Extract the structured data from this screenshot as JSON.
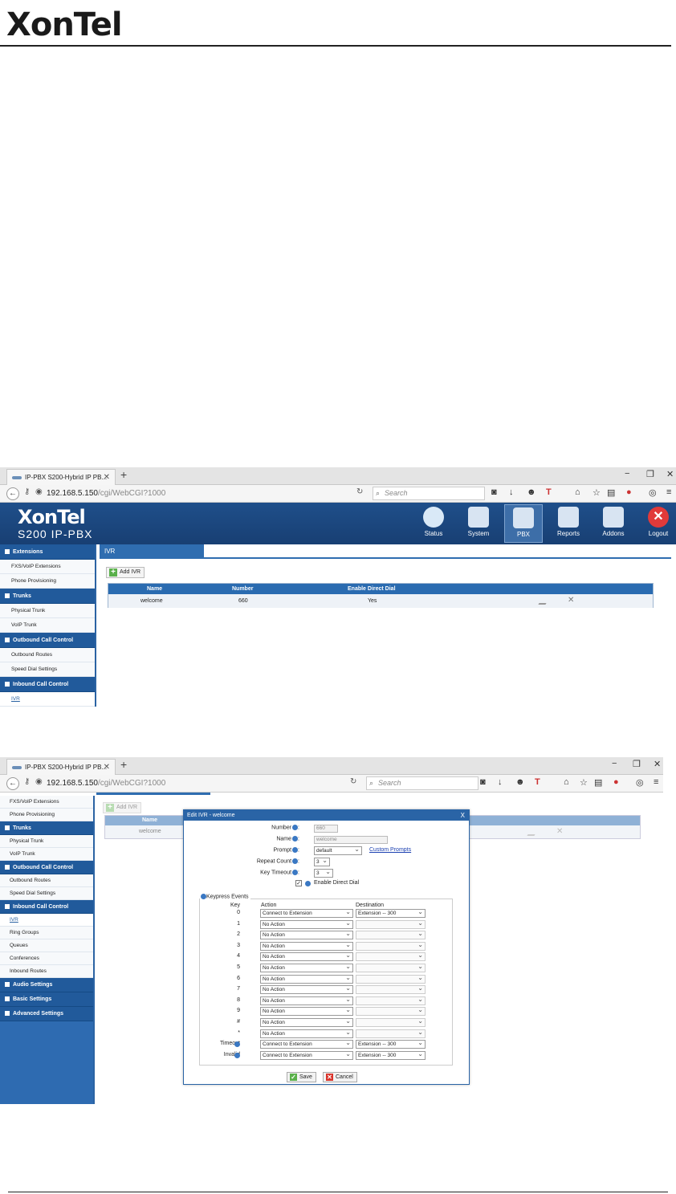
{
  "document": {
    "logo": "XonTel"
  },
  "browser": {
    "tab_title": "IP-PBX S200-Hybrid IP PB...",
    "url_host": "192.168.5.150",
    "url_path": "/cgi/WebCGI?1000",
    "search_placeholder": "Search"
  },
  "app": {
    "logo": "XonTel",
    "subtitle": "S200 IP-PBX",
    "nav": [
      {
        "label": "Status"
      },
      {
        "label": "System"
      },
      {
        "label": "PBX"
      },
      {
        "label": "Reports"
      },
      {
        "label": "Addons"
      },
      {
        "label": "Logout"
      }
    ]
  },
  "sidebar1": {
    "groups": [
      {
        "label": "Extensions",
        "items": [
          "FXS/VoIP Extensions",
          "Phone Provisioning"
        ]
      },
      {
        "label": "Trunks",
        "items": [
          "Physical Trunk",
          "VoIP Trunk"
        ]
      },
      {
        "label": "Outbound Call Control",
        "items": [
          "Outbound Routes",
          "Speed Dial Settings"
        ]
      },
      {
        "label": "Inbound Call Control",
        "items": [
          "IVR"
        ]
      }
    ]
  },
  "sidebar2": {
    "items_top": [
      "FXS/VoIP Extensions",
      "Phone Provisioning"
    ],
    "trunks": {
      "label": "Trunks",
      "items": [
        "Physical Trunk",
        "VoIP Trunk"
      ]
    },
    "outbound": {
      "label": "Outbound Call Control",
      "items": [
        "Outbound Routes",
        "Speed Dial Settings"
      ]
    },
    "inbound": {
      "label": "Inbound Call Control",
      "items": [
        "IVR",
        "Ring Groups",
        "Queues",
        "Conferences",
        "Inbound Routes"
      ]
    },
    "more": [
      "Audio Settings",
      "Basic Settings",
      "Advanced Settings"
    ]
  },
  "ivr_page": {
    "tab": "IVR",
    "add_button": "Add IVR",
    "columns": [
      "Name",
      "Number",
      "Enable Direct Dial"
    ],
    "rows": [
      {
        "name": "welcome",
        "number": "660",
        "direct_dial": "Yes"
      }
    ]
  },
  "dialog": {
    "title": "Edit IVR - welcome",
    "close": "X",
    "number_label": "Number",
    "number_value": "660",
    "name_label": "Name",
    "name_value": "welcome",
    "prompt_label": "Prompt",
    "prompt_value": "default",
    "custom_prompts_link": "Custom Prompts",
    "repeat_label": "Repeat Count",
    "repeat_value": "3",
    "timeout_label": "Key Timeout",
    "timeout_value": "3",
    "direct_dial_label": "Enable Direct Dial",
    "direct_dial_checked": true,
    "keypress_title": "Keypress Events",
    "col_key": "Key",
    "col_action": "Action",
    "col_destination": "Destination",
    "events": [
      {
        "key": "0",
        "action": "Connect to Extension",
        "destination": "Extension -- 300"
      },
      {
        "key": "1",
        "action": "No Action",
        "destination": ""
      },
      {
        "key": "2",
        "action": "No Action",
        "destination": ""
      },
      {
        "key": "3",
        "action": "No Action",
        "destination": ""
      },
      {
        "key": "4",
        "action": "No Action",
        "destination": ""
      },
      {
        "key": "5",
        "action": "No Action",
        "destination": ""
      },
      {
        "key": "6",
        "action": "No Action",
        "destination": ""
      },
      {
        "key": "7",
        "action": "No Action",
        "destination": ""
      },
      {
        "key": "8",
        "action": "No Action",
        "destination": ""
      },
      {
        "key": "9",
        "action": "No Action",
        "destination": ""
      },
      {
        "key": "#",
        "action": "No Action",
        "destination": ""
      },
      {
        "key": "*",
        "action": "No Action",
        "destination": ""
      },
      {
        "key": "Timeout",
        "action": "Connect to Extension",
        "destination": "Extension -- 300"
      },
      {
        "key": "Invalid",
        "action": "Connect to Extension",
        "destination": "Extension -- 300"
      }
    ],
    "save": "Save",
    "cancel": "Cancel"
  }
}
